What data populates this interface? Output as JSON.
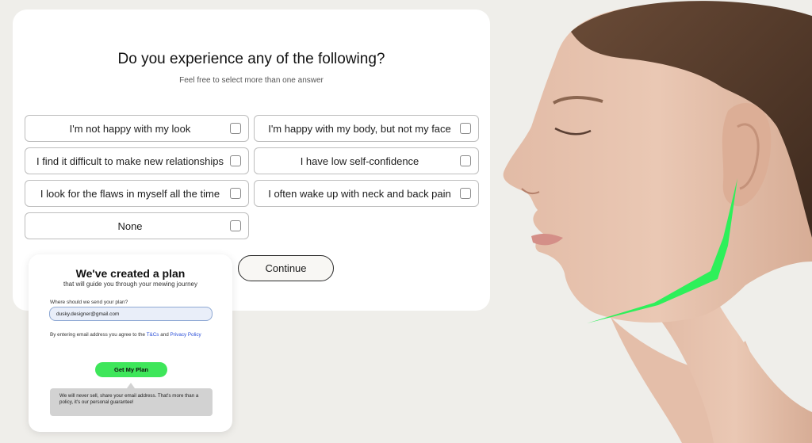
{
  "quiz": {
    "title": "Do you experience any of the following?",
    "subtitle": "Feel free to select more than one answer",
    "options": [
      {
        "label": "I'm not happy with my look",
        "checked": false
      },
      {
        "label": "I'm happy with my body, but not my face",
        "checked": false
      },
      {
        "label": "I find it difficult to make new relationships",
        "checked": false
      },
      {
        "label": "I have low self-confidence",
        "checked": false
      },
      {
        "label": "I look for the flaws in myself all the time",
        "checked": false
      },
      {
        "label": "I often wake up with neck and back pain",
        "checked": false
      },
      {
        "label": "None",
        "checked": false
      }
    ],
    "continue_label": "Continue"
  },
  "plan_card": {
    "title": "We've created a plan",
    "subtitle": "that will guide you through your mewing journey",
    "email_label": "Where should we send your plan?",
    "email_value": "dusky.designer@gmail.com",
    "agree_prefix": "By entering email address you agree to the ",
    "tcs_link": "T&Cs",
    "agree_and": " and ",
    "privacy_link": "Privacy Policy",
    "cta_label": "Get My Plan",
    "notice": "We will never sell, share your email address. That's more than a policy, it's our personal guarantee!"
  },
  "colors": {
    "page_bg": "#efeeea",
    "accent_green": "#3ee65a",
    "jawline_green": "#2ef05a",
    "link_blue": "#2b4fd8",
    "input_bg": "#e9eef9"
  }
}
